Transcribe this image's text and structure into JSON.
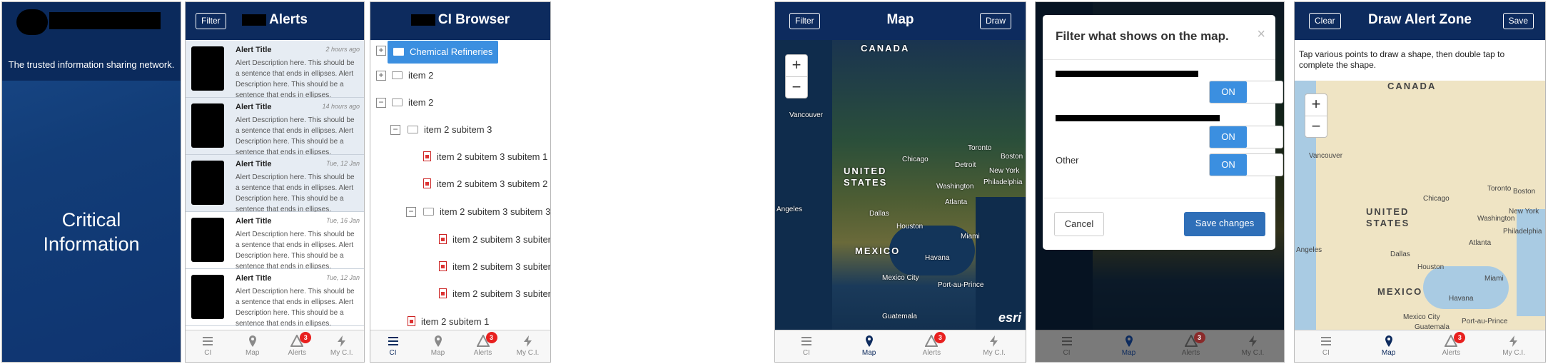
{
  "splash": {
    "tagline": "The trusted information sharing network.",
    "title_line1": "Critical",
    "title_line2": "Information"
  },
  "alerts_screen": {
    "filter_label": "Filter",
    "title": "Alerts",
    "items": [
      {
        "title": "Alert Title",
        "time": "2 hours ago",
        "desc": "Alert Description here. This should be a sentence that ends in ellipses. Alert Description here. This should be a sentence that ends in ellipses."
      },
      {
        "title": "Alert Title",
        "time": "14 hours ago",
        "desc": "Alert Description here. This should be a sentence that ends in ellipses. Alert Description here. This should be a sentence that ends in ellipses."
      },
      {
        "title": "Alert Title",
        "time": "Tue, 12 Jan",
        "desc": "Alert Description here. This should be a sentence that ends in ellipses. Alert Description here. This should be a sentence that ends in ellipses."
      },
      {
        "title": "Alert Title",
        "time": "Tue, 16 Jan",
        "desc": "Alert Description here. This should be a sentence that ends in ellipses. Alert Description here. This should be a sentence that ends in ellipses."
      },
      {
        "title": "Alert Title",
        "time": "Tue, 12 Jan",
        "desc": "Alert Description here. This should be a sentence that ends in ellipses. Alert Description here. This should be a sentence that ends in ellipses."
      }
    ]
  },
  "browser_screen": {
    "title": "CI Browser",
    "rows": [
      {
        "label": "Chemical Refineries"
      },
      {
        "label": "item 2"
      },
      {
        "label": "item 2"
      },
      {
        "label": "item 2 subitem 3"
      },
      {
        "label": "item 2 subitem 3 subitem 1"
      },
      {
        "label": "item 2 subitem 3 subitem 2"
      },
      {
        "label": "item 2 subitem 3 subitem 3"
      },
      {
        "label": "item 2 subitem 3 subitem 3 sub"
      },
      {
        "label": "item 2 subitem 3 subitem 3 sub"
      },
      {
        "label": "item 2 subitem 3 subitem 3 sub"
      },
      {
        "label": "item 2 subitem 1"
      }
    ]
  },
  "map_screen": {
    "filter_label": "Filter",
    "title": "Map",
    "draw_label": "Draw",
    "zoom_in": "+",
    "zoom_out": "−",
    "attribution": "esri",
    "labels": [
      "CANADA",
      "Vancouver",
      "UNITED",
      "STATES",
      "Chicago",
      "Toronto",
      "Detroit",
      "Boston",
      "New York",
      "Philadelphia",
      "Washington",
      "Atlanta",
      "Dallas",
      "Houston",
      "Angeles",
      "MEXICO",
      "Havana",
      "Miami",
      "Mexico City",
      "Port-au-Prince",
      "Guatemala"
    ]
  },
  "filter_modal": {
    "title": "Filter what shows on the map.",
    "close": "×",
    "other_label": "Other",
    "toggle_on": "ON",
    "cancel_label": "Cancel",
    "save_label": "Save changes"
  },
  "draw_screen": {
    "clear_label": "Clear",
    "title": "Draw Alert Zone",
    "save_label": "Save",
    "instructions": "Tap various points to draw a shape, then double tap to complete the shape.",
    "labels": [
      "CANADA",
      "Vancouver",
      "UNITED",
      "STATES",
      "Chicago",
      "Toronto",
      "Boston",
      "New York",
      "Philadelphia",
      "Washington",
      "Atlanta",
      "Dallas",
      "Houston",
      "Angeles",
      "MEXICO",
      "Havana",
      "Miami",
      "Mexico City",
      "Port-au-Prince",
      "Guatemala"
    ]
  },
  "tabs": [
    {
      "label": "CI",
      "icon": "list-icon"
    },
    {
      "label": "Map",
      "icon": "map-pin-icon"
    },
    {
      "label": "Alerts",
      "icon": "warning-icon",
      "badge": "3"
    },
    {
      "label": "My C.I.",
      "icon": "bolt-icon"
    }
  ],
  "colors": {
    "header": "#0d2b5e",
    "accent": "#3b8fe0",
    "badge": "#e8201f"
  }
}
